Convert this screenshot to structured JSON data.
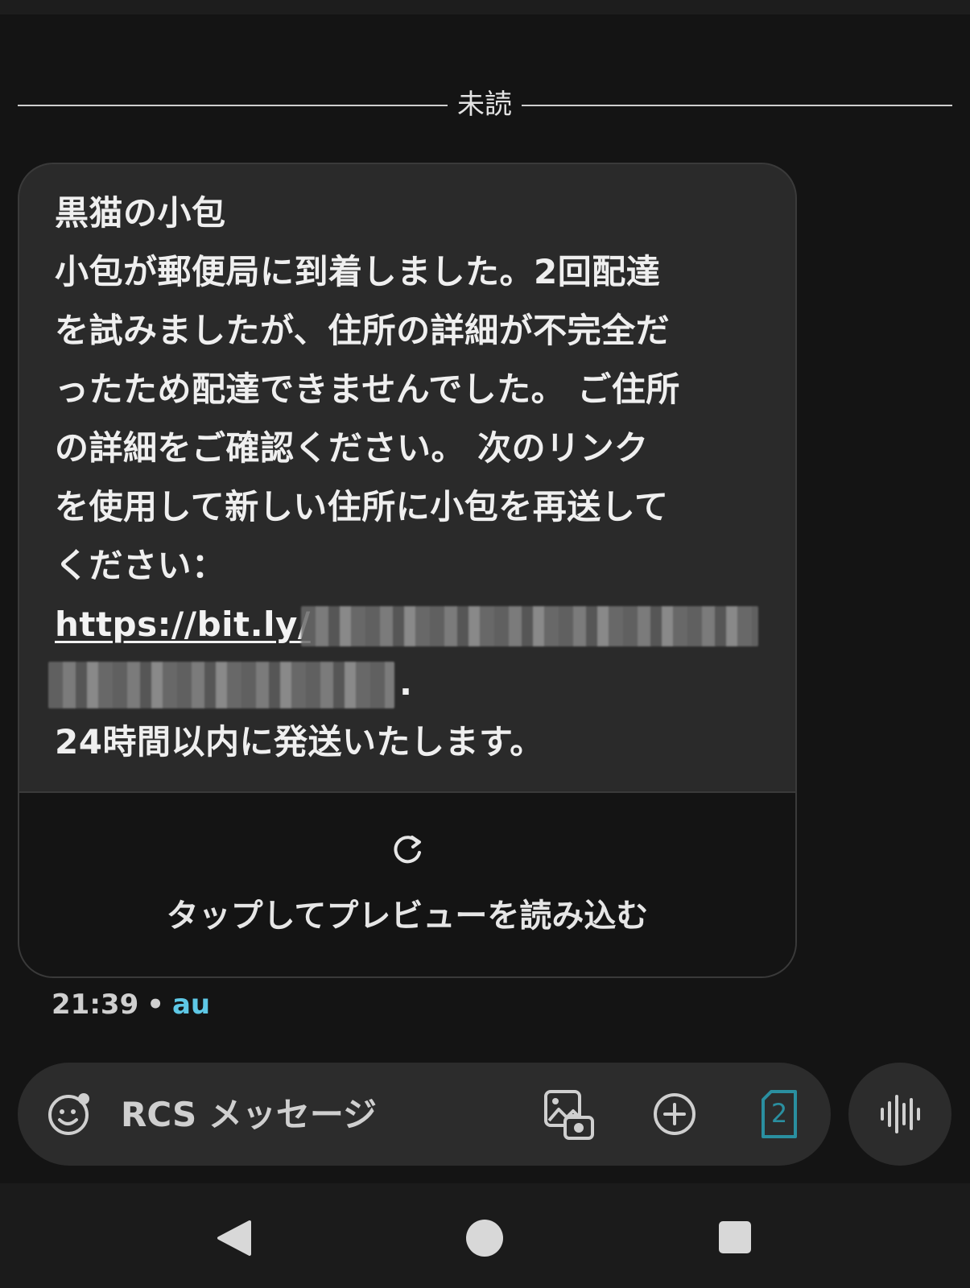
{
  "divider": {
    "label": "未読"
  },
  "message": {
    "lines": [
      "黒猫の小包",
      "小包が郵便局に到着しました。2回配達",
      "を試みましたが、住所の詳細が不完全だ",
      "ったため配達できませんでした。 ご住所",
      "の詳細をご確認ください。 次のリンク",
      "を使用して新しい住所に小包を再送して",
      "ください："
    ],
    "link_visible": "https://bit.ly/",
    "link_tail": ".",
    "final_line": "24時間以内に発送いたします。"
  },
  "preview": {
    "label": "タップしてプレビューを読み込む",
    "icon": "refresh-icon"
  },
  "meta": {
    "time": "21:39",
    "separator": "•",
    "carrier": "au"
  },
  "compose": {
    "placeholder": "RCS メッセージ",
    "sim_number": "2",
    "icons": [
      "emoji-icon",
      "gallery-icon",
      "add-icon",
      "sim-card-icon"
    ]
  },
  "voice": {
    "icon": "voice-waveform-icon"
  },
  "nav": {
    "icons": [
      "back-icon",
      "home-icon",
      "recents-icon"
    ]
  },
  "colors": {
    "background": "#141414",
    "bubble": "#2a2a2a",
    "carrier_accent": "#5ec8e6",
    "sim_accent": "#2a8fa0"
  }
}
